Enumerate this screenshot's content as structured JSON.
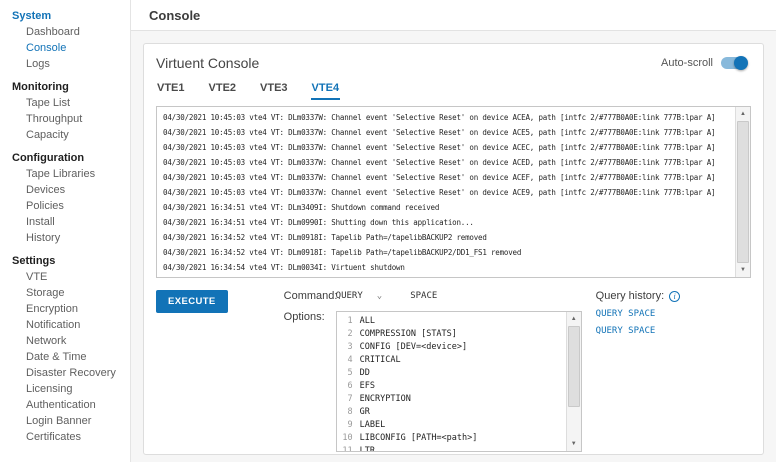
{
  "colors": {
    "accent": "#1273B7"
  },
  "icons": {
    "chevron_down": "⌄",
    "scroll_up": "▲",
    "scroll_down": "▼",
    "info": "i"
  },
  "header": {
    "title": "Console"
  },
  "sidebar": {
    "sections": [
      {
        "label": "System",
        "active": true,
        "items": [
          {
            "label": "Dashboard",
            "active": false
          },
          {
            "label": "Console",
            "active": true
          },
          {
            "label": "Logs",
            "active": false
          }
        ]
      },
      {
        "label": "Monitoring",
        "active": false,
        "items": [
          {
            "label": "Tape List",
            "active": false
          },
          {
            "label": "Throughput",
            "active": false
          },
          {
            "label": "Capacity",
            "active": false
          }
        ]
      },
      {
        "label": "Configuration",
        "active": false,
        "items": [
          {
            "label": "Tape Libraries",
            "active": false
          },
          {
            "label": "Devices",
            "active": false
          },
          {
            "label": "Policies",
            "active": false
          },
          {
            "label": "Install",
            "active": false
          },
          {
            "label": "History",
            "active": false
          }
        ]
      },
      {
        "label": "Settings",
        "active": false,
        "items": [
          {
            "label": "VTE",
            "active": false
          },
          {
            "label": "Storage",
            "active": false
          },
          {
            "label": "Encryption",
            "active": false
          },
          {
            "label": "Notification",
            "active": false
          },
          {
            "label": "Network",
            "active": false
          },
          {
            "label": "Date & Time",
            "active": false
          },
          {
            "label": "Disaster Recovery",
            "active": false
          },
          {
            "label": "Licensing",
            "active": false
          },
          {
            "label": "Authentication",
            "active": false
          },
          {
            "label": "Login Banner",
            "active": false
          },
          {
            "label": "Certificates",
            "active": false
          }
        ]
      }
    ]
  },
  "console": {
    "title": "Virtuent Console",
    "autoscroll_label": "Auto-scroll",
    "autoscroll_on": true,
    "tabs": [
      {
        "label": "VTE1",
        "active": false
      },
      {
        "label": "VTE2",
        "active": false
      },
      {
        "label": "VTE3",
        "active": false
      },
      {
        "label": "VTE4",
        "active": true
      }
    ],
    "log_lines": [
      "04/30/2021 10:45:03 vte4 VT: DLm0337W: Channel event 'Selective Reset' on device ACEA, path [intfc 2/#777B0A0E:link 777B:lpar A]",
      "04/30/2021 10:45:03 vte4 VT: DLm0337W: Channel event 'Selective Reset' on device ACE5, path [intfc 2/#777B0A0E:link 777B:lpar A]",
      "04/30/2021 10:45:03 vte4 VT: DLm0337W: Channel event 'Selective Reset' on device ACEC, path [intfc 2/#777B0A0E:link 777B:lpar A]",
      "04/30/2021 10:45:03 vte4 VT: DLm0337W: Channel event 'Selective Reset' on device ACED, path [intfc 2/#777B0A0E:link 777B:lpar A]",
      "04/30/2021 10:45:03 vte4 VT: DLm0337W: Channel event 'Selective Reset' on device ACEF, path [intfc 2/#777B0A0E:link 777B:lpar A]",
      "04/30/2021 10:45:03 vte4 VT: DLm0337W: Channel event 'Selective Reset' on device ACE9, path [intfc 2/#777B0A0E:link 777B:lpar A]",
      "04/30/2021 16:34:51 vte4 VT: DLm3409I: Shutdown command received",
      "04/30/2021 16:34:51 vte4 VT: DLm0990I: Shutting down this application...",
      "04/30/2021 16:34:52 vte4 VT: DLm0918I: Tapelib Path=/tapelibBACKUP2 removed",
      "04/30/2021 16:34:52 vte4 VT: DLm0918I: Tapelib Path=/tapelibBACKUP2/DD1_FS1 removed",
      "04/30/2021 16:34:54 vte4 VT: DLm0034I: Virtuent shutdown"
    ]
  },
  "command_panel": {
    "execute_label": "EXECUTE",
    "command_label": "Command:",
    "command_value": "QUERY",
    "command_arg": "SPACE",
    "options_label": "Options:",
    "options": [
      "ALL",
      "COMPRESSION [STATS]",
      "CONFIG [DEV=<device>]",
      "CRITICAL",
      "DD",
      "EFS",
      "ENCRYPTION",
      "GR",
      "LABEL",
      "LIBCONFIG [PATH=<path>]",
      "LTR"
    ],
    "query_history_label": "Query history:",
    "history": [
      "QUERY SPACE",
      "QUERY SPACE"
    ]
  }
}
